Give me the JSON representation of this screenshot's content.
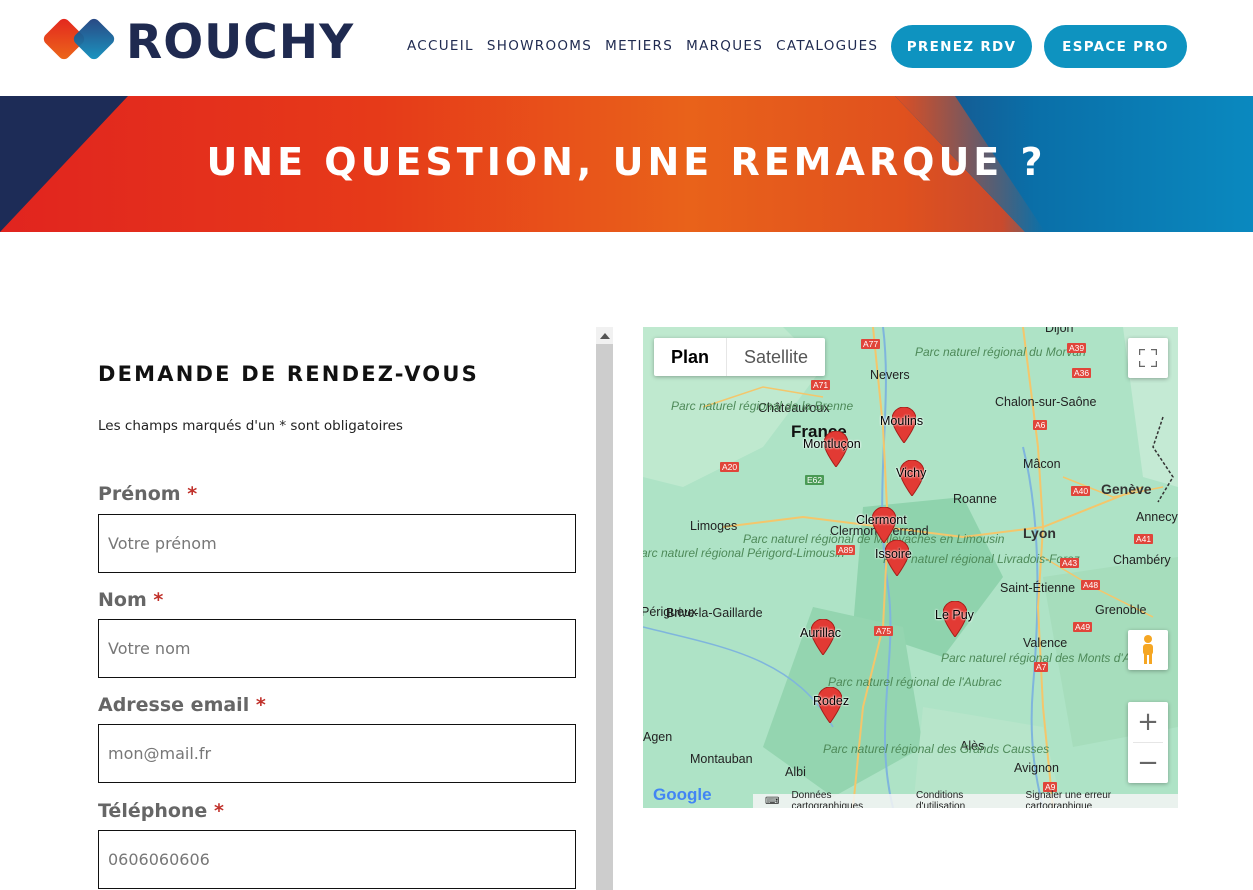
{
  "header": {
    "brand": "ROUCHY",
    "nav": [
      "ACCUEIL",
      "SHOWROOMS",
      "METIERS",
      "MARQUES",
      "CATALOGUES"
    ],
    "cta_rdv": "PRENEZ RDV",
    "cta_pro": "ESPACE PRO",
    "colors": {
      "navy": "#1f2a50",
      "accent": "#0e93c0",
      "red": "#e1241f",
      "orange": "#e9621a"
    }
  },
  "banner": {
    "title": "UNE QUESTION, UNE REMARQUE ?"
  },
  "form": {
    "title": "DEMANDE DE RENDEZ-VOUS",
    "note": "Les champs marqués d'un * sont obligatoires",
    "required_mark": "*",
    "fields": [
      {
        "label": "Prénom",
        "placeholder": "Votre prénom"
      },
      {
        "label": "Nom",
        "placeholder": "Votre nom"
      },
      {
        "label": "Adresse email",
        "placeholder": "mon@mail.fr"
      },
      {
        "label": "Téléphone",
        "placeholder": "0606060606"
      }
    ]
  },
  "map": {
    "type_plan": "Plan",
    "type_satellite": "Satellite",
    "zoom_in": "+",
    "zoom_out": "−",
    "google": "Google",
    "footer": [
      "Données cartographiques",
      "Conditions d'utilisation",
      "Signaler une erreur cartographique"
    ],
    "markers": [
      "Moulins",
      "Montluçon",
      "Vichy",
      "Clermont",
      "Issoire",
      "Le Puy",
      "Aurillac",
      "Rodez"
    ],
    "cities": [
      "Dijon",
      "Nevers",
      "Châteauroux",
      "France",
      "Chalon-sur-Saône",
      "Mâcon",
      "Genève",
      "Annecy",
      "Roanne",
      "Lyon",
      "Chambéry",
      "Limoges",
      "Clermont-Ferrand",
      "Saint-Étienne",
      "Grenoble",
      "Valence",
      "Brive-la-Gaillarde",
      "Périgueux",
      "Montauban",
      "Albi",
      "Alès",
      "Avignon",
      "Agen"
    ],
    "parks": [
      "Parc naturel régional du Morvan",
      "Parc naturel régional de la Brenne",
      "Parc naturel régional de Millevaches en Limousin",
      "Parc naturel régional Livradois-Forez",
      "Parc naturel régional des Monts d'Ardèche",
      "Parc naturel régional de l'Aubrac",
      "Parc naturel régional des Grands Causses",
      "Parc naturel régional Périgord-Limousin"
    ],
    "roads": [
      "A77",
      "A71",
      "A20",
      "E62",
      "A89",
      "A75",
      "A39",
      "A36",
      "A6",
      "A40",
      "A41",
      "A43",
      "A48",
      "A49",
      "A7",
      "A9"
    ]
  }
}
